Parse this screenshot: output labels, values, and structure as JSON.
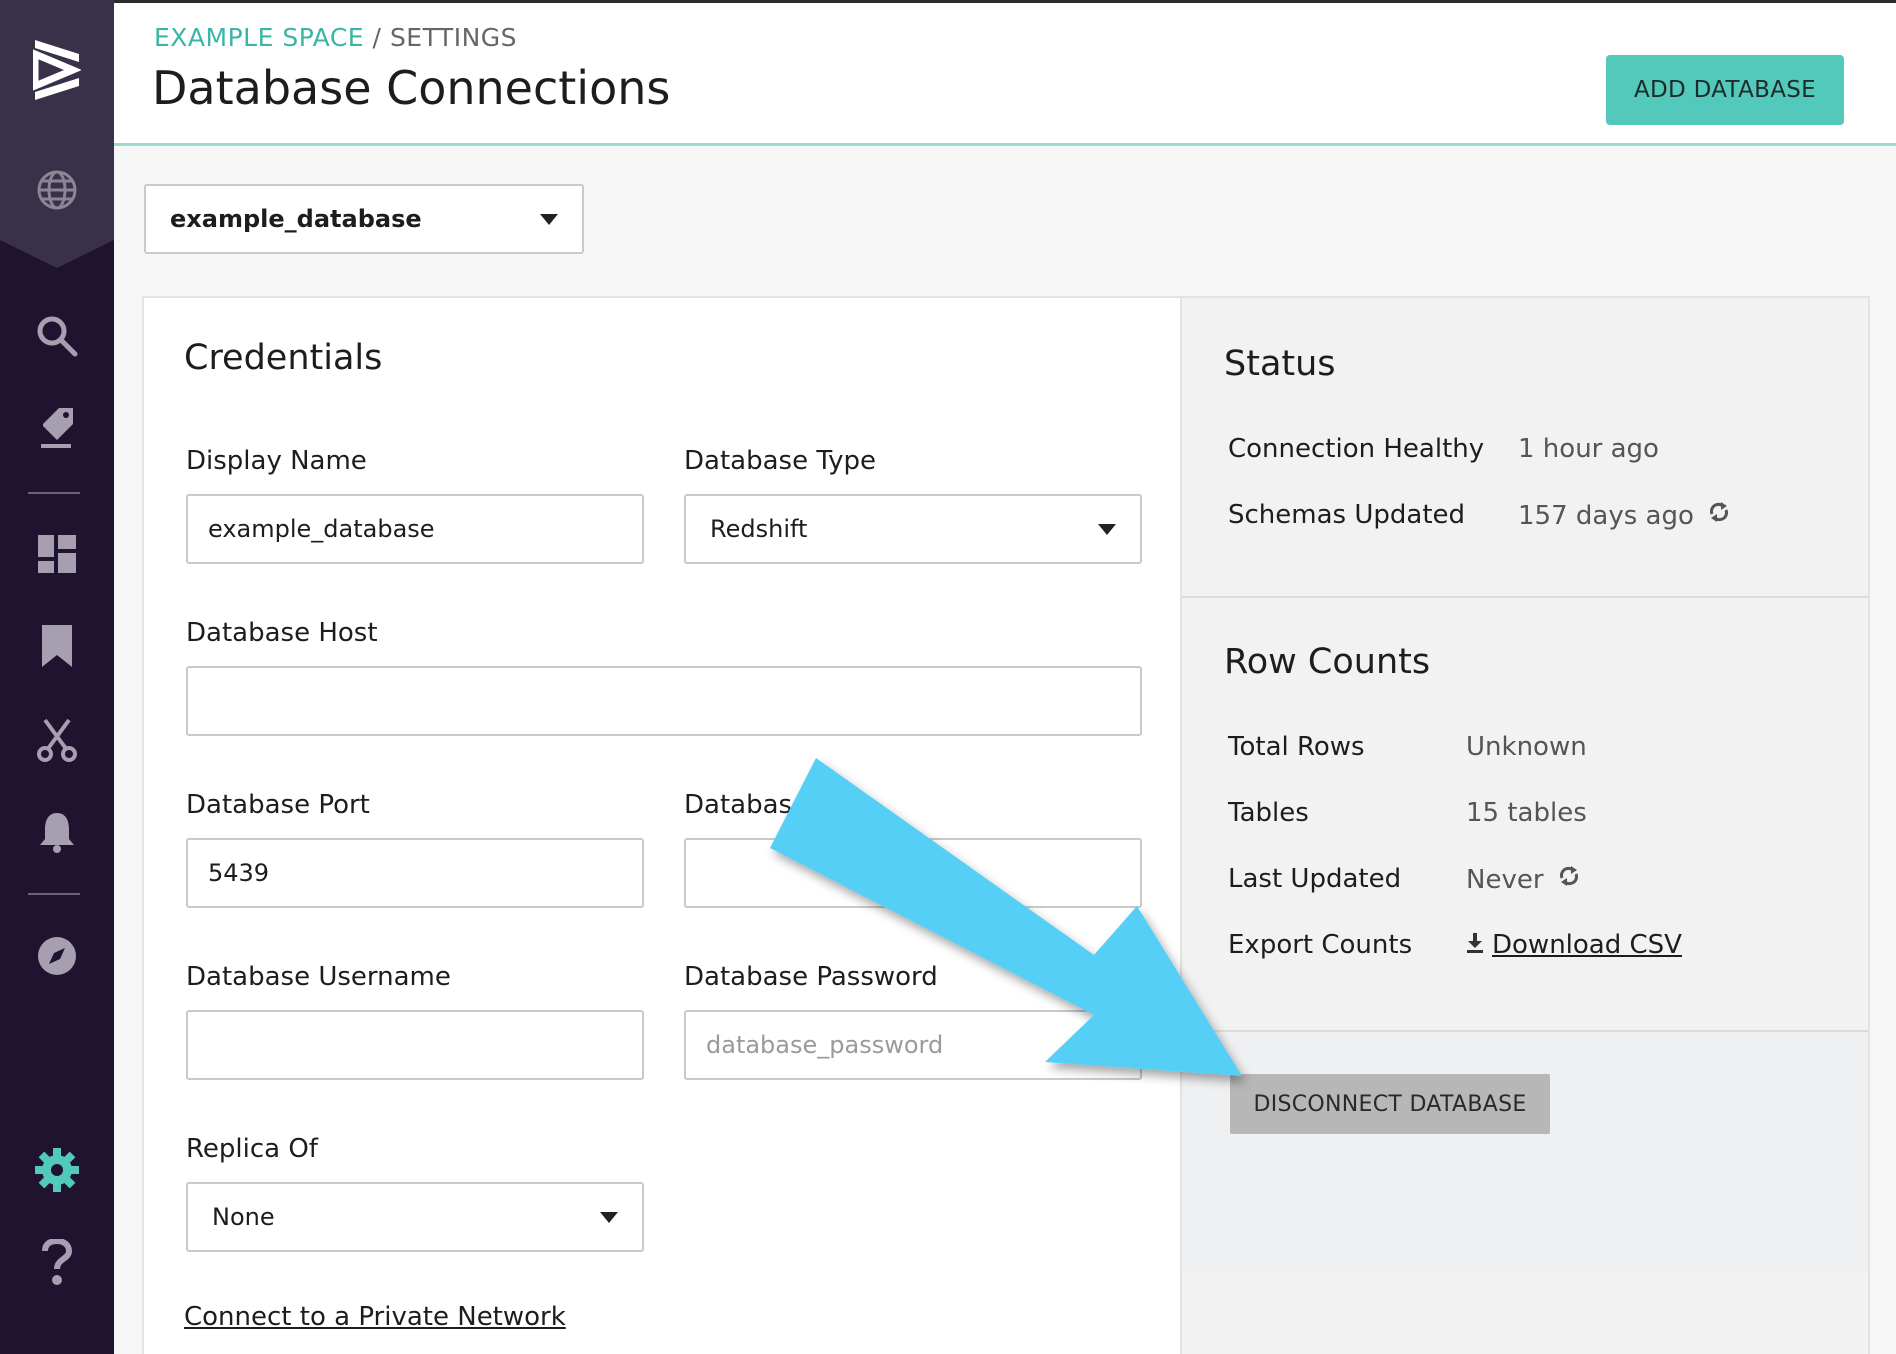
{
  "sidebar": {
    "icons": [
      "logo-icon",
      "globe-icon",
      "search-icon",
      "tag-icon",
      "dashboard-icon",
      "bookmark-icon",
      "scissors-icon",
      "bell-icon",
      "compass-icon",
      "gear-icon",
      "help-icon"
    ]
  },
  "header": {
    "breadcrumb_space": "EXAMPLE SPACE",
    "breadcrumb_sep": " / ",
    "breadcrumb_settings": "SETTINGS",
    "title": "Database Connections",
    "add_button": "ADD DATABASE"
  },
  "db_select": {
    "value": "example_database"
  },
  "credentials": {
    "title": "Credentials",
    "display_name_label": "Display Name",
    "display_name_value": "example_database",
    "db_type_label": "Database Type",
    "db_type_value": "Redshift",
    "host_label": "Database Host",
    "host_value": "",
    "port_label": "Database Port",
    "port_value": "5439",
    "db_name_label": "Databas",
    "db_name_value": "",
    "username_label": "Database Username",
    "username_value": "",
    "password_label": "Database Password",
    "password_placeholder": "database_password",
    "replica_label": "Replica Of",
    "replica_value": "None",
    "private_network_link": "Connect to a Private Network"
  },
  "status": {
    "title": "Status",
    "rows": [
      {
        "label": "Connection Healthy",
        "value": "1 hour ago"
      },
      {
        "label": "Schemas Updated",
        "value": "157 days ago"
      }
    ]
  },
  "row_counts": {
    "title": "Row Counts",
    "rows": [
      {
        "label": "Total Rows",
        "value": "Unknown"
      },
      {
        "label": "Tables",
        "value": "15 tables"
      },
      {
        "label": "Last Updated",
        "value": "Never"
      },
      {
        "label": "Export Counts",
        "value": "Download CSV"
      }
    ]
  },
  "disconnect_button": "DISCONNECT DATABASE",
  "colors": {
    "sidebar_bg": "#1f1330",
    "accent_teal": "#52c9bb",
    "arrow": "#55cff5"
  }
}
